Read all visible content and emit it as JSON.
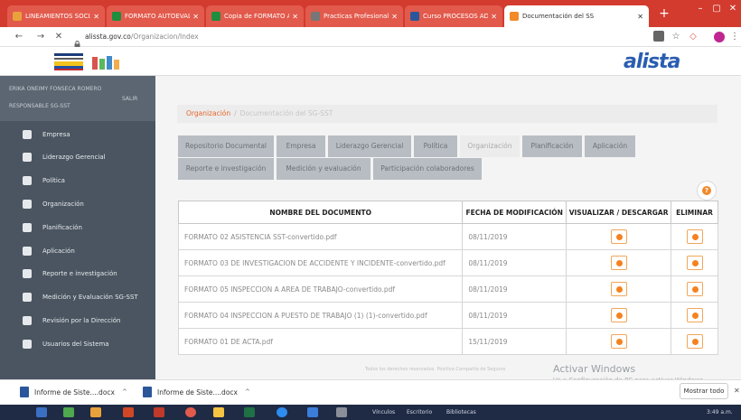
{
  "browser": {
    "tabs": [
      {
        "label": "LINEAMIENTOS SOCIAL",
        "icon": "document-icon",
        "color": "#e9a23b"
      },
      {
        "label": "FORMATO AUTOEVALU",
        "icon": "sheets-icon",
        "color": "#1e8e3e"
      },
      {
        "label": "Copia de FORMATO AU",
        "icon": "sheets-icon",
        "color": "#1e8e3e"
      },
      {
        "label": "Practicas Profesionales",
        "icon": "chrome-icon",
        "color": "#777777"
      },
      {
        "label": "Curso PROCESOS ADM",
        "icon": "document-icon",
        "color": "#2b579a"
      },
      {
        "label": "Documentación del SS",
        "icon": "site-icon",
        "color": "#f08a2b"
      }
    ],
    "new_tab": "+",
    "window_controls": [
      "–",
      "▢",
      "✕"
    ],
    "url_host": "alissta.gov.co",
    "url_path": "/Organizacion/Index"
  },
  "sidebar": {
    "user_name": "ERIKA ONEIMY FONSECA ROMERO",
    "user_role": "RESPONSABLE SG-SST",
    "logout": "SALIR",
    "items": [
      {
        "label": "Empresa",
        "icon": "building-icon"
      },
      {
        "label": "Liderazgo Gerencial",
        "icon": "group-icon"
      },
      {
        "label": "Política",
        "icon": "person-icon"
      },
      {
        "label": "Organización",
        "icon": "list-icon"
      },
      {
        "label": "Planificación",
        "icon": "person-badge-icon"
      },
      {
        "label": "Aplicación",
        "icon": "hand-icon"
      },
      {
        "label": "Reporte e investigación",
        "icon": "search-icon"
      },
      {
        "label": "Medición y Evaluación SG-SST",
        "icon": "pie-chart-icon"
      },
      {
        "label": "Revisión por la Dirección",
        "icon": "user-icon"
      },
      {
        "label": "Usuarios del Sistema",
        "icon": "users-icon"
      }
    ],
    "collapse_icon": "‹"
  },
  "header": {
    "logo_text": "alista"
  },
  "breadcrumb": {
    "link": "Organización",
    "separator": "/",
    "current": "Documentación del SG-SST"
  },
  "tabs_row1": [
    "Repositorio Documental",
    "Empresa",
    "Liderazgo Gerencial",
    "Política",
    "Organización",
    "Planificación",
    "Aplicación"
  ],
  "tabs_row2": [
    "Reporte e investigación",
    "Medición y evaluación",
    "Participación colaboradores"
  ],
  "active_tab": "Organización",
  "help": "?",
  "table": {
    "headers": [
      "NOMBRE DEL DOCUMENTO",
      "FECHA DE MODIFICACIÓN",
      "VISUALIZAR / DESCARGAR",
      "ELIMINAR"
    ],
    "rows": [
      {
        "name": "FORMATO 02 ASISTENCIA SST-convertido.pdf",
        "date": "08/11/2019"
      },
      {
        "name": "FORMATO 03 DE INVESTIGACION DE ACCIDENTE Y INCIDENTE-convertido.pdf",
        "date": "08/11/2019"
      },
      {
        "name": "FORMATO 05 INSPECCION A AREA DE TRABAJO-convertido.pdf",
        "date": "08/11/2019"
      },
      {
        "name": "FORMATO 04 INSPECCION A PUESTO DE TRABAJO (1) (1)-convertido.pdf",
        "date": "08/11/2019"
      },
      {
        "name": "FORMATO 01 DE ACTA.pdf",
        "date": "15/11/2019"
      }
    ]
  },
  "footer": {
    "text": "Todos los derechos reservados. Positiva Compañía de Seguros",
    "activate_title": "Activar Windows",
    "activate_sub": "Ve a Configuración de PC para activar Windows."
  },
  "downloads": {
    "items": [
      "Informe de Siste....docx",
      "Informe de Siste....docx"
    ],
    "show_all": "Mostrar todo"
  },
  "taskbar": {
    "labels": [
      "Vínculos",
      "Escritorio",
      "Bibliotecas"
    ],
    "clock": "3:49 a.m."
  }
}
